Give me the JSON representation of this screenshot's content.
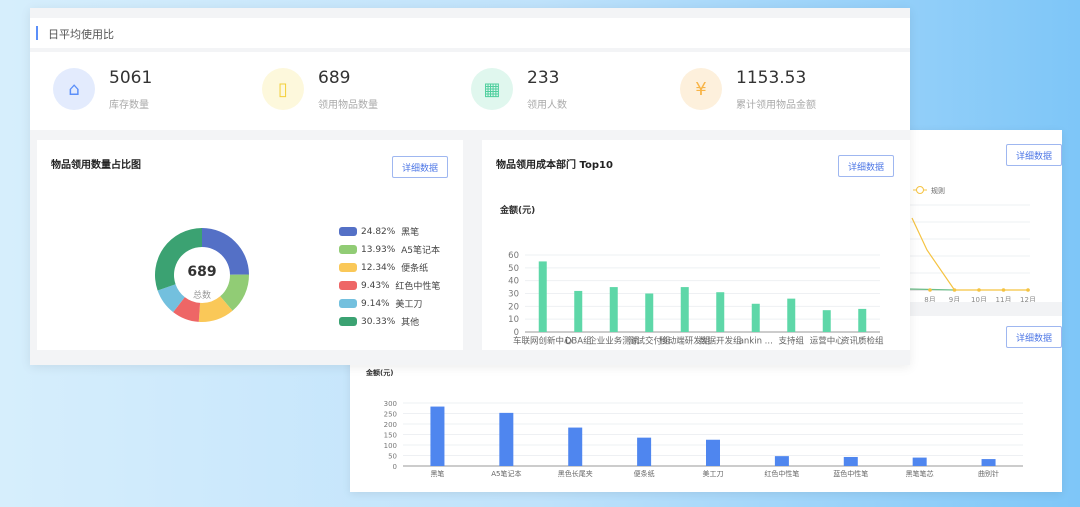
{
  "header": {
    "title": "日平均使用比"
  },
  "stats": [
    {
      "value": "5061",
      "label": "库存数量",
      "icon": "warehouse-icon",
      "color": "#5b8ff9",
      "bg": "#e3ebfd"
    },
    {
      "value": "689",
      "label": "领用物品数量",
      "icon": "hand-item-icon",
      "color": "#f4cf3a",
      "bg": "#fdf8dc"
    },
    {
      "value": "233",
      "label": "领用人数",
      "icon": "person-card-icon",
      "color": "#4fcf9e",
      "bg": "#e0f7ee"
    },
    {
      "value": "1153.53",
      "label": "累计领用物品金额",
      "icon": "yen-coin-icon",
      "color": "#f8b447",
      "bg": "#fdf0dc"
    }
  ],
  "detail_label": "详细数据",
  "donut_card": {
    "title": "物品领用数量占比图",
    "center_value": "689",
    "center_label": "总数"
  },
  "bar_card": {
    "title": "物品领用成本部门 Top10"
  },
  "line_card": {
    "legend": "规则"
  },
  "chart_data": [
    {
      "type": "pie",
      "donut": true,
      "slices": [
        {
          "label": "黑笔",
          "percent": "24.82%",
          "value": 24.82,
          "color": "#5470c6"
        },
        {
          "label": "A5笔记本",
          "percent": "13.93%",
          "value": 13.93,
          "color": "#91cc75"
        },
        {
          "label": "便条纸",
          "percent": "12.34%",
          "value": 12.34,
          "color": "#fac858"
        },
        {
          "label": "红色中性笔",
          "percent": "9.43%",
          "value": 9.43,
          "color": "#ee6666"
        },
        {
          "label": "美工刀",
          "percent": "9.14%",
          "value": 9.14,
          "color": "#73c0de"
        },
        {
          "label": "其他",
          "percent": "30.33%",
          "value": 30.33,
          "color": "#3ba272"
        }
      ]
    },
    {
      "type": "bar",
      "ylabel": "金额(元)",
      "ylim": [
        0,
        60
      ],
      "yticks": [
        0,
        10,
        20,
        30,
        40,
        50,
        60
      ],
      "color": "#5ed7a8",
      "categories": [
        "车联网创新中心",
        "DBA组",
        "企业业务测试",
        "测试交付组",
        "移动端研发组",
        "数据开发组",
        "ankin ...",
        "支持组",
        "运营中心",
        "资讯质检组"
      ],
      "values": [
        55,
        32,
        35,
        30,
        35,
        31,
        22,
        26,
        17,
        18
      ]
    },
    {
      "type": "line",
      "legend": "规则",
      "categories": [
        "8月",
        "9月",
        "10月",
        "11月",
        "12月"
      ],
      "series": [
        {
          "values": [
            null,
            0,
            0,
            0,
            0
          ],
          "color": "#f5c342"
        },
        {
          "values": [
            0,
            0,
            0,
            0,
            0
          ],
          "color": "#6dbf8a"
        }
      ]
    },
    {
      "type": "bar",
      "ylabel": "金额(元)",
      "ylim": [
        0,
        300
      ],
      "yticks": [
        0,
        50,
        100,
        150,
        200,
        250,
        300
      ],
      "color": "#4f86ef",
      "categories": [
        "黑笔",
        "A5笔记本",
        "黑色长尾夹",
        "便条纸",
        "美工刀",
        "红色中性笔",
        "蓝色中性笔",
        "黑笔笔芯",
        "曲别针"
      ],
      "values": [
        283,
        253,
        183,
        135,
        125,
        47,
        43,
        40,
        33
      ]
    }
  ]
}
